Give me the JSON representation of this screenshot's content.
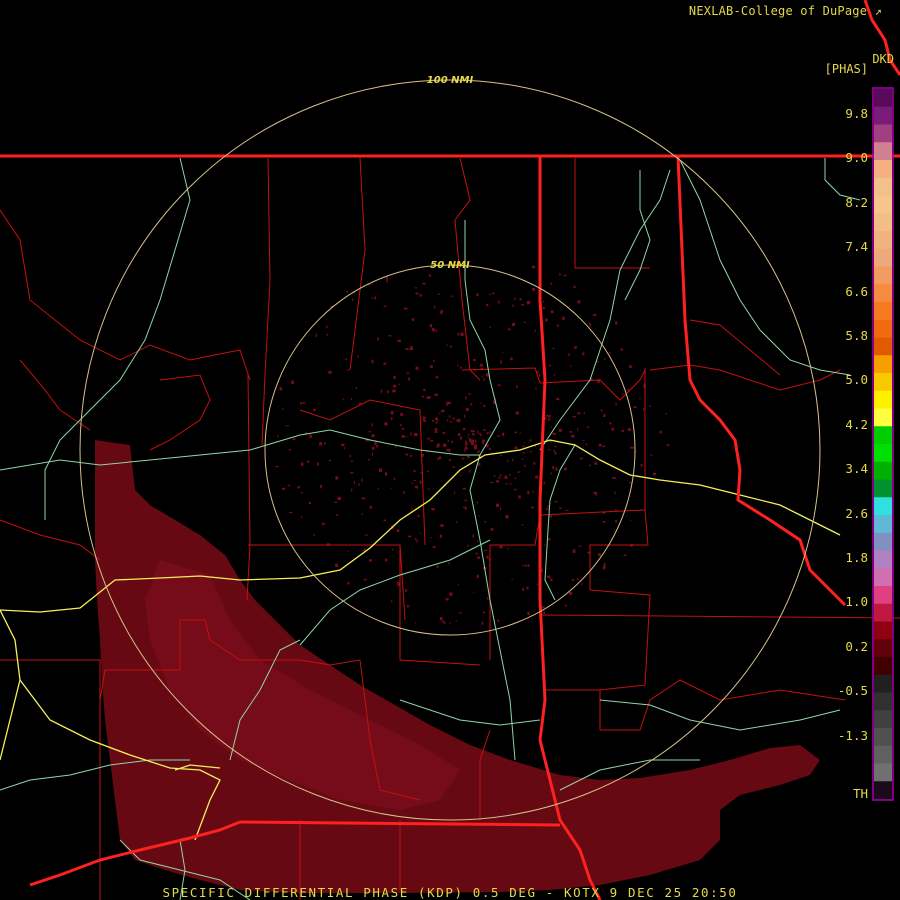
{
  "credit": "NEXLAB-College of DuPage",
  "credit_mark": "↗",
  "product_code": "DKD",
  "units": "[PHAS]",
  "footer": "SPECIFIC DIFFERENTIAL PHASE (KDP) 0.5 DEG - KOTX 9 DEC 25 20:50",
  "rings": [
    {
      "label": "100 NMI",
      "color": "#d8c08a"
    },
    {
      "label": "50 NMI",
      "color": "#d8c08a"
    }
  ],
  "colorbar": {
    "ticks": [
      "9.8",
      "9.0",
      "8.2",
      "7.4",
      "6.6",
      "5.8",
      "5.0",
      "4.2",
      "3.4",
      "2.6",
      "1.8",
      "1.0",
      "0.2",
      "-0.5",
      "-1.3",
      "TH"
    ],
    "colors": [
      "#5a0a5a",
      "#7a1a7a",
      "#a04080",
      "#d08090",
      "#f4b080",
      "#f4c08a",
      "#f6c58c",
      "#f3bd86",
      "#f0b380",
      "#eea97a",
      "#f29a60",
      "#f58a40",
      "#f77a20",
      "#f06a10",
      "#e05a00",
      "#f5a000",
      "#f8c800",
      "#fff000",
      "#ffff40",
      "#00cc00",
      "#00e000",
      "#00b000",
      "#009030",
      "#30e0e0",
      "#60b8d8",
      "#8090c0",
      "#b080c0",
      "#d070b0",
      "#e04080",
      "#c01840",
      "#900010",
      "#600008",
      "#400000",
      "#202020",
      "#303030",
      "#404040",
      "#505050",
      "#606060",
      "#707070",
      "#1a0a1a"
    ]
  },
  "colors": {
    "state_lines": "#ff2020",
    "county_lines": "#d01010",
    "highways_major": "#f5f05a",
    "highways_minor": "#8fd6a8",
    "echo": "#6b0a14"
  }
}
